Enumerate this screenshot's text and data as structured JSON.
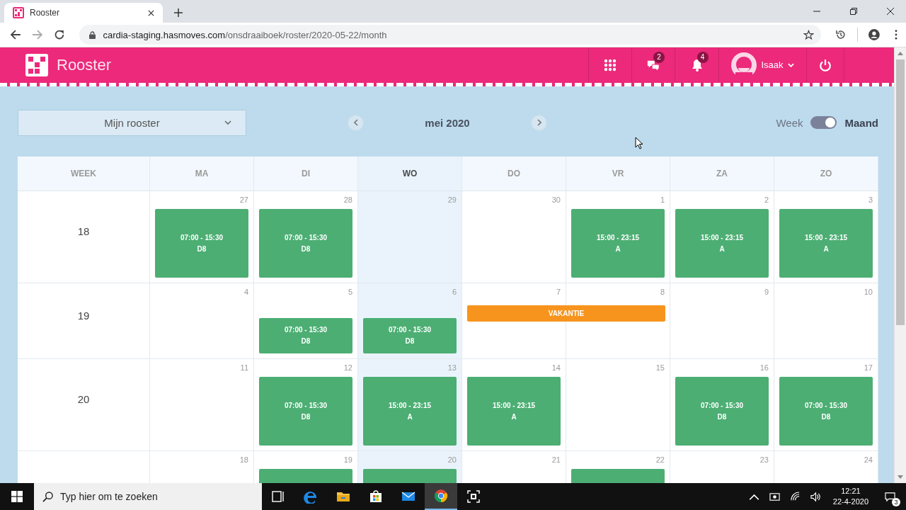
{
  "browser": {
    "tab_title": "Rooster",
    "url_host": "cardia-staging.hasmoves.com",
    "url_path": "/onsdraaiboek/roster/2020-05-22/month"
  },
  "app_header": {
    "title": "Rooster",
    "messages_badge": "2",
    "notifications_badge": "4",
    "user_name": "Isaak"
  },
  "toolbar": {
    "schedule_select": "Mijn rooster",
    "month": "mei 2020",
    "view_toggle": {
      "left_label": "Week",
      "right_label": "Maand",
      "on": true
    }
  },
  "calendar": {
    "columns": [
      {
        "label": "WEEK",
        "selected": false
      },
      {
        "label": "MA",
        "selected": false
      },
      {
        "label": "DI",
        "selected": false
      },
      {
        "label": "WO",
        "selected": true
      },
      {
        "label": "DO",
        "selected": false
      },
      {
        "label": "VR",
        "selected": false
      },
      {
        "label": "ZA",
        "selected": false
      },
      {
        "label": "ZO",
        "selected": false
      }
    ],
    "weeks": [
      {
        "number": "18",
        "days": [
          {
            "date": "27",
            "vacation": false,
            "events": [
              {
                "kind": "shift",
                "time": "07:00 - 15:30",
                "code": "D8"
              }
            ]
          },
          {
            "date": "28",
            "vacation": false,
            "events": [
              {
                "kind": "shift",
                "time": "07:00 - 15:30",
                "code": "D8"
              }
            ]
          },
          {
            "date": "29",
            "vacation": false
          },
          {
            "date": "30",
            "vacation": false
          },
          {
            "date": "1",
            "vacation": false,
            "events": [
              {
                "kind": "shift",
                "time": "15:00 - 23:15",
                "code": "A"
              }
            ]
          },
          {
            "date": "2",
            "vacation": false,
            "events": [
              {
                "kind": "shift",
                "time": "15:00 - 23:15",
                "code": "A"
              }
            ]
          },
          {
            "date": "3",
            "vacation": false,
            "events": [
              {
                "kind": "shift",
                "time": "15:00 - 23:15",
                "code": "A"
              }
            ]
          }
        ]
      },
      {
        "number": "19",
        "vacation_label": "VAKANTIE",
        "days": [
          {
            "date": "4",
            "vacation": false
          },
          {
            "date": "5",
            "vacation": false,
            "events": [
              {
                "kind": "shift",
                "time": "07:00 - 15:30",
                "code": "D8"
              }
            ]
          },
          {
            "date": "6",
            "vacation": false,
            "events": [
              {
                "kind": "shift",
                "time": "07:00 - 15:30",
                "code": "D8"
              }
            ]
          },
          {
            "date": "7",
            "vacation": true
          },
          {
            "date": "8",
            "vacation": true
          },
          {
            "date": "9",
            "vacation": false
          },
          {
            "date": "10",
            "vacation": false
          }
        ]
      },
      {
        "number": "20",
        "days": [
          {
            "date": "11",
            "vacation": false
          },
          {
            "date": "12",
            "vacation": false,
            "events": [
              {
                "kind": "shift",
                "time": "07:00 - 15:30",
                "code": "D8"
              }
            ]
          },
          {
            "date": "13",
            "vacation": false,
            "events": [
              {
                "kind": "shift",
                "time": "15:00 - 23:15",
                "code": "A"
              }
            ]
          },
          {
            "date": "14",
            "vacation": false,
            "events": [
              {
                "kind": "shift",
                "time": "15:00 - 23:15",
                "code": "A"
              }
            ]
          },
          {
            "date": "15",
            "vacation": false
          },
          {
            "date": "16",
            "vacation": false,
            "events": [
              {
                "kind": "shift",
                "time": "07:00 - 15:30",
                "code": "D8"
              }
            ]
          },
          {
            "date": "17",
            "vacation": false,
            "events": [
              {
                "kind": "shift",
                "time": "07:00 - 15:30",
                "code": "D8"
              }
            ]
          }
        ]
      },
      {
        "days": [
          {
            "date": "18",
            "vacation": false
          },
          {
            "date": "19",
            "vacation": false,
            "events": [
              {
                "kind": "shift"
              }
            ]
          },
          {
            "date": "20",
            "vacation": false,
            "events": [
              {
                "kind": "shift"
              }
            ]
          },
          {
            "date": "21",
            "vacation": false
          },
          {
            "date": "22",
            "vacation": false,
            "events": [
              {
                "kind": "shift"
              }
            ]
          },
          {
            "date": "23",
            "vacation": false
          },
          {
            "date": "24",
            "vacation": false
          }
        ]
      }
    ]
  },
  "taskbar": {
    "search_placeholder": "Typ hier om te zoeken",
    "apps": [
      {
        "kind": "task-view",
        "selected": false
      },
      {
        "kind": "edge",
        "selected": false
      },
      {
        "kind": "explorer",
        "selected": false
      },
      {
        "kind": "store",
        "selected": false
      },
      {
        "kind": "mail",
        "selected": false
      },
      {
        "kind": "chrome",
        "selected": true
      },
      {
        "kind": "snip",
        "selected": false
      }
    ],
    "time": "12:21",
    "date": "22-4-2020",
    "notifications_badge": "3"
  }
}
